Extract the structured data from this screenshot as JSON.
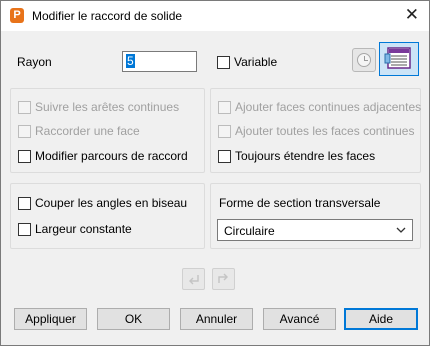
{
  "window": {
    "title": "Modifier le raccord de solide",
    "app_icon_letter": "P"
  },
  "radius": {
    "label": "Rayon",
    "value": "5"
  },
  "variable": {
    "label": "Variable",
    "checked": false
  },
  "left_options": [
    {
      "label": "Suivre les arêtes continues",
      "checked": false,
      "enabled": false
    },
    {
      "label": "Raccorder une face",
      "checked": false,
      "enabled": false
    },
    {
      "label": "Modifier parcours de raccord",
      "checked": false,
      "enabled": true
    }
  ],
  "right_options": [
    {
      "label": "Ajouter faces continues adjacentes",
      "checked": false,
      "enabled": false
    },
    {
      "label": "Ajouter toutes les faces continues",
      "checked": false,
      "enabled": false
    },
    {
      "label": "Toujours étendre les faces",
      "checked": false,
      "enabled": true
    }
  ],
  "corner_options": [
    {
      "label": "Couper les angles en biseau",
      "checked": false,
      "enabled": true
    },
    {
      "label": "Largeur constante",
      "checked": false,
      "enabled": true
    }
  ],
  "cross_section": {
    "label": "Forme de section transversale",
    "selected": "Circulaire"
  },
  "buttons": {
    "apply": "Appliquer",
    "ok": "OK",
    "cancel": "Annuler",
    "advanced": "Avancé",
    "help": "Aide"
  },
  "icons": {
    "close": "close-icon",
    "timer": "clock-icon",
    "form": "form-table-icon",
    "back": "back-arrow-icon",
    "forward": "forward-arrow-icon"
  },
  "colors": {
    "accent": "#0078d7",
    "app_icon": "#e8731a",
    "window_bg": "#f0f0f0",
    "disabled_text": "#a0a0a0"
  }
}
